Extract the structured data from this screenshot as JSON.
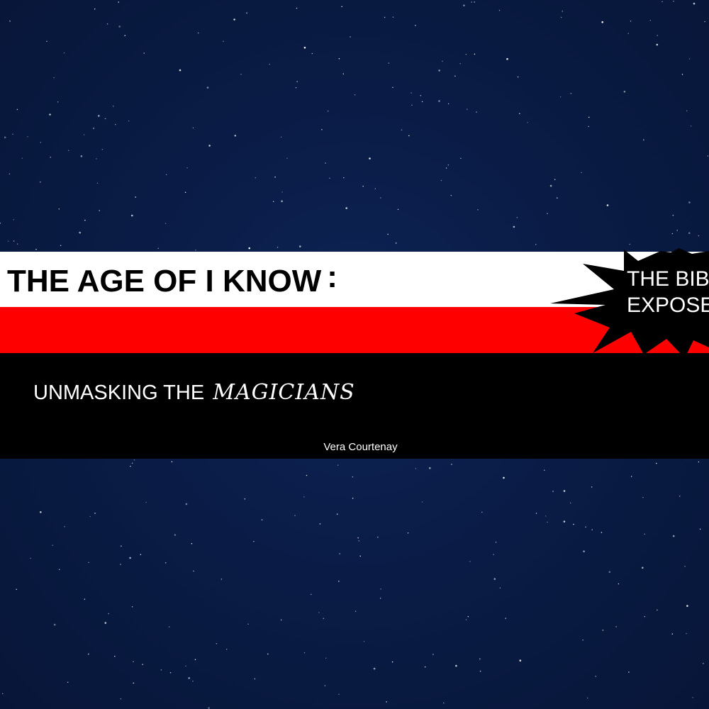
{
  "slide": {
    "title": "THE AGE OF I KNOW",
    "title_punct": ":",
    "subtitle_plain": "UNMASKING THE",
    "subtitle_emphasis": "MAGICIANS",
    "author": "Vera Courtenay",
    "burst": {
      "line1": "THE BIB",
      "line2": "EXPOSE"
    }
  },
  "colors": {
    "background": "#0a1c46",
    "star": "#ffffff",
    "band_white": "#ffffff",
    "band_red": "#ff0000",
    "band_black": "#000000",
    "burst": "#000000"
  }
}
